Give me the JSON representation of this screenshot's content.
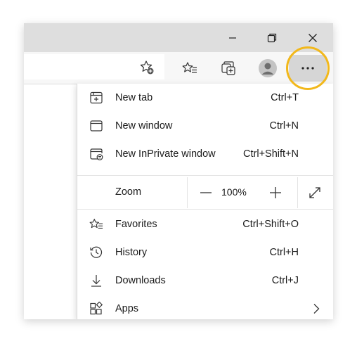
{
  "menu": {
    "items": [
      {
        "label": "New tab",
        "shortcut": "Ctrl+T",
        "icon": "new-tab-icon"
      },
      {
        "label": "New window",
        "shortcut": "Ctrl+N",
        "icon": "new-window-icon"
      },
      {
        "label": "New InPrivate window",
        "shortcut": "Ctrl+Shift+N",
        "icon": "inprivate-icon"
      },
      {
        "label": "Favorites",
        "shortcut": "Ctrl+Shift+O",
        "icon": "favorites-icon"
      },
      {
        "label": "History",
        "shortcut": "Ctrl+H",
        "icon": "history-icon"
      },
      {
        "label": "Downloads",
        "shortcut": "Ctrl+J",
        "icon": "download-icon"
      },
      {
        "label": "Apps",
        "shortcut": "",
        "icon": "apps-icon"
      }
    ],
    "zoom": {
      "label": "Zoom",
      "value": "100%",
      "decrease_icon": "minus-icon",
      "increase_icon": "plus-icon",
      "fullscreen_icon": "fullscreen-icon"
    }
  },
  "colors": {
    "highlight": "#f2b81b",
    "titlebar": "#dedede",
    "toolbar": "#f7f7f7"
  }
}
